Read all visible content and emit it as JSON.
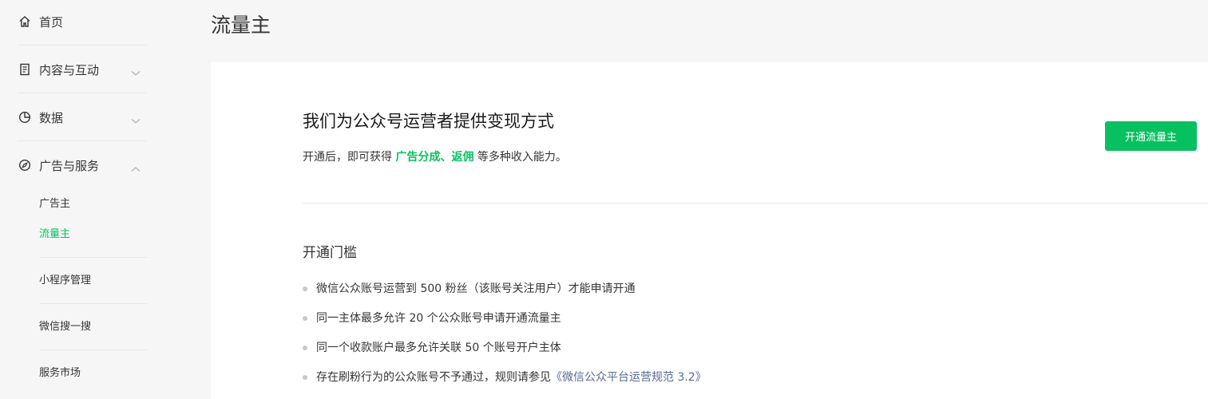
{
  "sidebar": {
    "items": [
      {
        "label": "首页",
        "icon": "home-icon"
      },
      {
        "label": "内容与互动",
        "icon": "document-icon",
        "expandable": true,
        "expanded": false
      },
      {
        "label": "数据",
        "icon": "pie-chart-icon",
        "expandable": true,
        "expanded": false
      },
      {
        "label": "广告与服务",
        "icon": "compass-icon",
        "expandable": true,
        "expanded": true
      }
    ],
    "sub_items": [
      {
        "label": "广告主",
        "active": false
      },
      {
        "label": "流量主",
        "active": true
      },
      {
        "label": "小程序管理",
        "active": false
      },
      {
        "label": "微信搜一搜",
        "active": false
      },
      {
        "label": "服务市场",
        "active": false
      }
    ]
  },
  "page": {
    "title": "流量主"
  },
  "hero": {
    "title": "我们为公众号运营者提供变现方式",
    "desc_prefix": "开通后，即可获得",
    "desc_highlight": "广告分成、返佣",
    "desc_suffix": "等多种收入能力。",
    "button_label": "开通流量主"
  },
  "requirements": {
    "title": "开通门槛",
    "items": [
      "微信公众账号运营到 500 粉丝（该账号关注用户）才能申请开通",
      "同一主体最多允许 20 个公众账号申请开通流量主",
      "同一个收款账户最多允许关联 50 个账号开户主体",
      "存在刷粉行为的公众账号不予通过，规则请参见"
    ],
    "link_label": "《微信公众平台运营规范 3.2》"
  },
  "colors": {
    "accent": "#07c160",
    "link": "#576b95"
  }
}
